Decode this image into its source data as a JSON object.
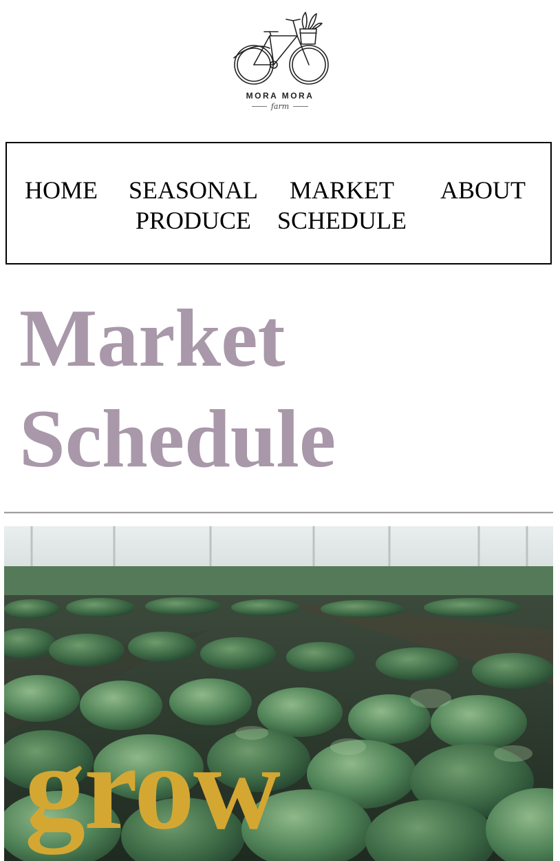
{
  "logo": {
    "name": "MORA MORA",
    "subtitle": "farm"
  },
  "nav": {
    "items": [
      {
        "label": "HOME"
      },
      {
        "label": "SEASONAL PRODUCE"
      },
      {
        "label": "MARKET SCHEDULE"
      },
      {
        "label": "ABOUT"
      }
    ]
  },
  "page": {
    "title": "Market Schedule"
  },
  "hero": {
    "word": "grow"
  },
  "colors": {
    "title": "#a898a9",
    "hero_word": "#d4a733",
    "nav_border": "#000000"
  }
}
